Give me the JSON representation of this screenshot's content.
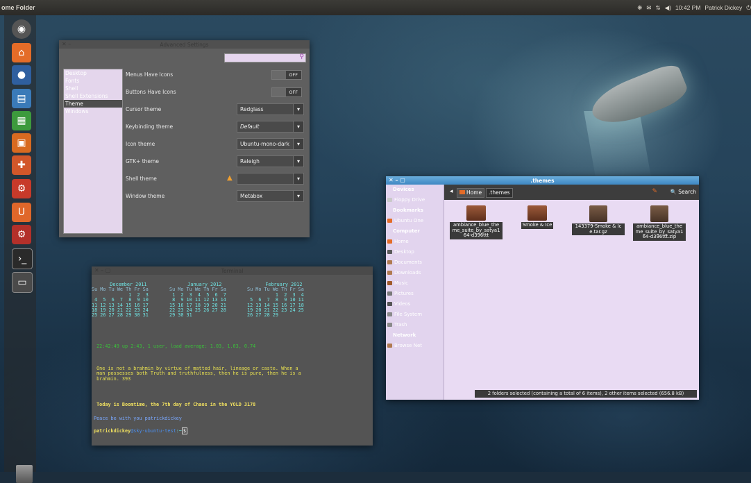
{
  "top_panel": {
    "title": "ome Folder",
    "tray": {
      "time": "10:42 PM",
      "user": "Patrick Dickey",
      "volume": "◀)",
      "network": "⇅",
      "mail": "✉",
      "indicator": "❋",
      "power": "⏻"
    }
  },
  "launcher": {
    "items": [
      "dash-icon",
      "home-folder-icon",
      "firefox-icon",
      "writer-icon",
      "calc-icon",
      "impress-icon",
      "software-center-icon",
      "settings-icon",
      "ubuntu-one-icon",
      "system-settings-icon",
      "terminal-icon",
      "advanced-settings-icon",
      "trash-icon"
    ]
  },
  "advanced_settings": {
    "title": "Advanced Settings",
    "window_controls": "✕ –",
    "search_placeholder": "",
    "sidebar": [
      "Desktop",
      "Fonts",
      "Shell",
      "Shell Extensions",
      "Theme",
      "Windows"
    ],
    "selected_sidebar": "Theme",
    "rows": [
      {
        "label": "Menus Have Icons",
        "kind": "toggle",
        "value": "OFF"
      },
      {
        "label": "Buttons Have Icons",
        "kind": "toggle",
        "value": "OFF"
      },
      {
        "label": "Cursor theme",
        "kind": "combo",
        "value": "Redglass"
      },
      {
        "label": "Keybinding theme",
        "kind": "combo",
        "value": "Default"
      },
      {
        "label": "Icon theme",
        "kind": "combo",
        "value": "Ubuntu-mono-dark"
      },
      {
        "label": "GTK+ theme",
        "kind": "combo",
        "value": "Raleigh"
      },
      {
        "label": "Shell theme",
        "kind": "combo",
        "value": ""
      },
      {
        "label": "Window theme",
        "kind": "combo",
        "value": "Metabox"
      }
    ]
  },
  "terminal": {
    "title": "Terminal",
    "window_controls": "✕ – ▢",
    "cal_months": [
      {
        "header": "December 2011",
        "days": "Su Mo Tu We Th Fr Sa",
        "weeks": [
          "             1  2  3",
          " 4  5  6  7  8  9 10",
          "11 12 13 14 15 16 17",
          "18 19 20 21 22 23 24",
          "25 26 27 28 29 30 31"
        ]
      },
      {
        "header": "January 2012",
        "days": "Su Mo Tu We Th Fr Sa",
        "weeks": [
          " 1  2  3  4  5  6  7",
          " 8  9 10 11 12 13 14",
          "15 16 17 18 19 20 21",
          "22 23 24 25 26 27 28",
          "29 30 31"
        ]
      },
      {
        "header": "February 2012",
        "days": "Su Mo Tu We Th Fr Sa",
        "weeks": [
          "          1  2  3  4",
          " 5  6  7  8  9 10 11",
          "12 13 14 15 16 17 18",
          "19 20 21 22 23 24 25",
          "26 27 28 29"
        ]
      }
    ],
    "uptime": " 22:42:49 up 2:43, 1 user, load average: 1.03, 1.03, 0.74",
    "quote": [
      " One is not a brahmin by virtue of matted hair, lineage or caste. When a",
      " man possesses both Truth and truthfulness, then he is pure, then he is a",
      " brahmin. 393"
    ],
    "ddate": " Today is Boomtime, the 7th day of Chaos in the YOLD 3178",
    "peace": "Peace be with you patrickdickey",
    "prompt_user": "patrickdickey",
    "prompt_host": "@sky-ubuntu-test",
    "prompt_tail": ":~",
    "prompt_symbol": "$"
  },
  "file_manager": {
    "title": ".themes",
    "window_controls": "✕ – ▢",
    "sidebar": [
      {
        "text": "Devices",
        "kind": "header"
      },
      {
        "text": "Floppy Drive",
        "kind": "item",
        "color": "#c9c9c9"
      },
      {
        "text": "Bookmarks",
        "kind": "header"
      },
      {
        "text": "Ubuntu One",
        "kind": "item",
        "color": "#e46c28"
      },
      {
        "text": "Computer",
        "kind": "header"
      },
      {
        "text": "Home",
        "kind": "item",
        "color": "#e46c28"
      },
      {
        "text": "Desktop",
        "kind": "item",
        "color": "#5a5a5a"
      },
      {
        "text": "Documents",
        "kind": "item",
        "color": "#b07a50"
      },
      {
        "text": "Downloads",
        "kind": "item",
        "color": "#b07a50"
      },
      {
        "text": "Music",
        "kind": "item",
        "color": "#a05a2a"
      },
      {
        "text": "Pictures",
        "kind": "item",
        "color": "#7a7a7a"
      },
      {
        "text": "Videos",
        "kind": "item",
        "color": "#555555"
      },
      {
        "text": "File System",
        "kind": "item",
        "color": "#8a8a8a"
      },
      {
        "text": "Trash",
        "kind": "item",
        "color": "#8a8a8a"
      },
      {
        "text": "Network",
        "kind": "header"
      },
      {
        "text": "Browse Net",
        "kind": "item",
        "color": "#b07a50"
      }
    ],
    "toolbar": {
      "back": "◂",
      "crumb_home": "Home",
      "crumb_current": ".themes",
      "search": "Search",
      "search_icon": "🔍",
      "edit_icon": "✎"
    },
    "files": [
      {
        "name": "ambiance_blue_theme_suite_by_satya164-d396ttt",
        "type": "folder"
      },
      {
        "name": "Smoke & Ice",
        "type": "folder"
      },
      {
        "name": "143379-Smoke & Ice.tar.gz",
        "type": "archive"
      },
      {
        "name": "ambiance_blue_theme_suite_by_satya164-d396ttt.zip",
        "type": "archive"
      }
    ],
    "status": "2 folders selected (containing a total of 6 items), 2 other items selected (656.8 kB)"
  },
  "colors": {
    "accent_orange": "#e46c28",
    "terminal_cyan": "#6fe3e3",
    "terminal_green": "#5fdc5f",
    "terminal_yellow": "#f0e060",
    "terminal_blue": "#7aa8ff",
    "selection_blue": "#3e87c2",
    "lilac": "#e9dbf3"
  }
}
